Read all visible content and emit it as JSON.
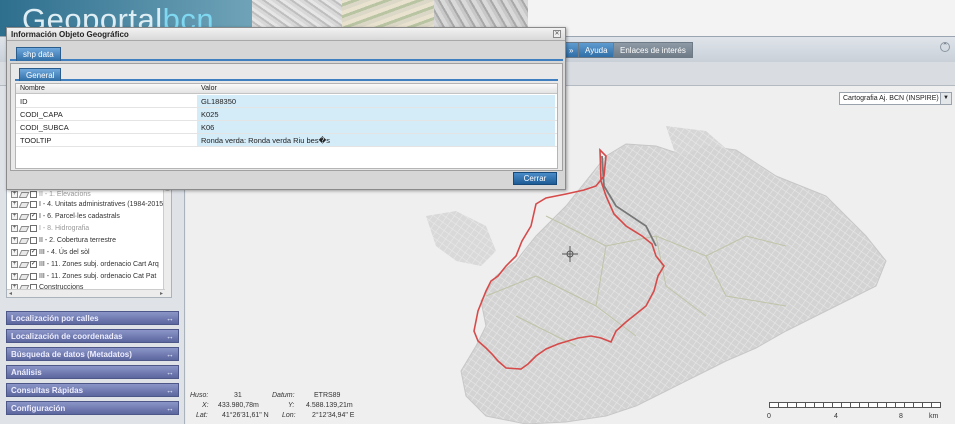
{
  "header": {
    "logo_main": "Geoportal",
    "logo_accent": "bcn"
  },
  "menu": {
    "tabs": [
      {
        "label": "»"
      },
      {
        "label": "Ayuda"
      },
      {
        "label": "Enlaces de interés"
      }
    ]
  },
  "map": {
    "cartography_select": "Cartografia Aj. BCN (INSPIRE)",
    "scale_labels": [
      "0",
      "4",
      "8",
      "km"
    ],
    "boundary_color": "#e05656"
  },
  "layers": [
    {
      "label": "II - 1. Elevacions",
      "checked": false,
      "dim": true
    },
    {
      "label": "I - 4. Unitats administratives (1984-2015)",
      "checked": false,
      "dim": false
    },
    {
      "label": "I - 6. Parcel·les cadastrals",
      "checked": true,
      "dim": false
    },
    {
      "label": "I - 8. Hidrografia",
      "checked": false,
      "dim": true
    },
    {
      "label": "II - 2. Cobertura terrestre",
      "checked": false,
      "dim": false
    },
    {
      "label": "III - 4. Ús del sòl",
      "checked": true,
      "dim": false
    },
    {
      "label": "III - 11. Zones subj. ordenacio Cart Arq",
      "checked": true,
      "dim": false
    },
    {
      "label": "III - 11. Zones subj. ordenacio Cat Pat",
      "checked": false,
      "dim": false
    },
    {
      "label": "Construccions",
      "checked": false,
      "dim": false
    }
  ],
  "accordion": [
    {
      "label": "Localización por calles"
    },
    {
      "label": "Localización de coordenadas"
    },
    {
      "label": "Búsqueda de datos (Metadatos)"
    },
    {
      "label": "Análisis"
    },
    {
      "label": "Consultas Rápidas"
    },
    {
      "label": "Configuración"
    }
  ],
  "coords": {
    "huso_label": "Huso:",
    "huso": "31",
    "datum_label": "Datum:",
    "datum": "ETRS89",
    "x_label": "X:",
    "x": "433.980,78m",
    "y_label": "Y:",
    "y": "4.588.139,21m",
    "lat_label": "Lat:",
    "lat": "41°26'31,61\" N",
    "lon_label": "Lon:",
    "lon": "2°12'34,94\" E"
  },
  "dialog": {
    "title": "Información Objeto Geográfico",
    "tab_outer": "shp data",
    "tab_inner": "General",
    "col_name": "Nombre",
    "col_value": "Valor",
    "rows": [
      {
        "name": "ID",
        "value": "GL188350"
      },
      {
        "name": "CODI_CAPA",
        "value": "K025"
      },
      {
        "name": "CODI_SUBCA",
        "value": "K06"
      },
      {
        "name": "TOOLTIP",
        "value": "Ronda verda: Ronda verda Riu bes�s"
      }
    ],
    "close_button": "Cerrar"
  }
}
